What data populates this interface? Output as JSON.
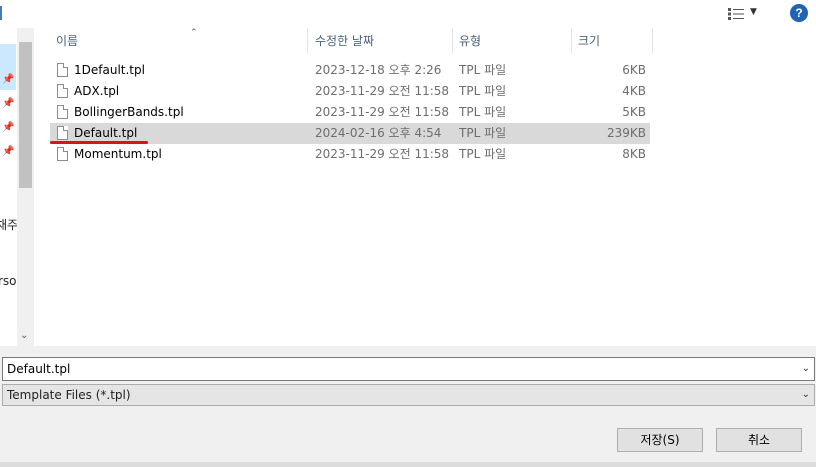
{
  "toolbar": {
    "view_icon": "view-options-icon",
    "help_label": "?"
  },
  "nav": {
    "items": [
      "채주",
      "rsoı"
    ]
  },
  "file_list": {
    "columns": {
      "name": "이름",
      "date": "수정한 날짜",
      "type": "유형",
      "size": "크기"
    },
    "rows": [
      {
        "name": "1Default.tpl",
        "date": "2023-12-18 오후 2:26",
        "type": "TPL 파일",
        "size": "6KB"
      },
      {
        "name": "ADX.tpl",
        "date": "2023-11-29 오전 11:58",
        "type": "TPL 파일",
        "size": "4KB"
      },
      {
        "name": "BollingerBands.tpl",
        "date": "2023-11-29 오전 11:58",
        "type": "TPL 파일",
        "size": "5KB"
      },
      {
        "name": "Default.tpl",
        "date": "2024-02-16 오후 4:54",
        "type": "TPL 파일",
        "size": "239KB"
      },
      {
        "name": "Momentum.tpl",
        "date": "2023-11-29 오전 11:58",
        "type": "TPL 파일",
        "size": "8KB"
      }
    ],
    "selected_index": 3
  },
  "form": {
    "filename": "Default.tpl",
    "filetype": "Template Files (*.tpl)"
  },
  "buttons": {
    "save": "저장(S)",
    "cancel": "취소"
  },
  "colors": {
    "annotation": "#d7141b",
    "selection": "#d9d9d9",
    "help": "#1f63b6"
  }
}
